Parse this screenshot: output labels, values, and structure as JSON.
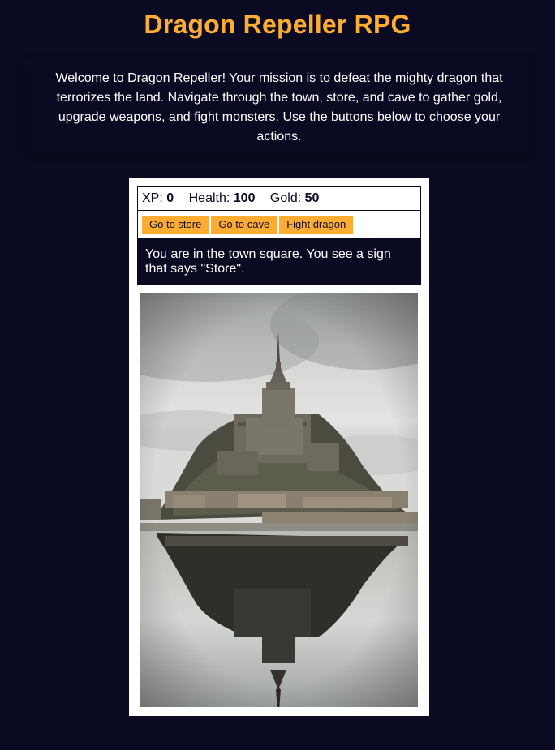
{
  "page": {
    "title": "Dragon Repeller RPG",
    "intro": "Welcome to Dragon Repeller! Your mission is to defeat the mighty dragon that terrorizes the land. Navigate through the town, store, and cave to gather gold, upgrade weapons, and fight monsters. Use the buttons below to choose your actions."
  },
  "stats": {
    "xp_label": "XP:",
    "xp_value": "0",
    "health_label": "Health:",
    "health_value": "100",
    "gold_label": "Gold:",
    "gold_value": "50"
  },
  "controls": {
    "button1": "Go to store",
    "button2": "Go to cave",
    "button3": "Fight dragon"
  },
  "location": {
    "text": "You are in the town square. You see a sign that says \"Store\"."
  },
  "scene": {
    "image_icon": "castle-island-photo"
  },
  "colors": {
    "background": "#0a0a23",
    "accent": "#feac32",
    "panel": "#ffffff"
  }
}
